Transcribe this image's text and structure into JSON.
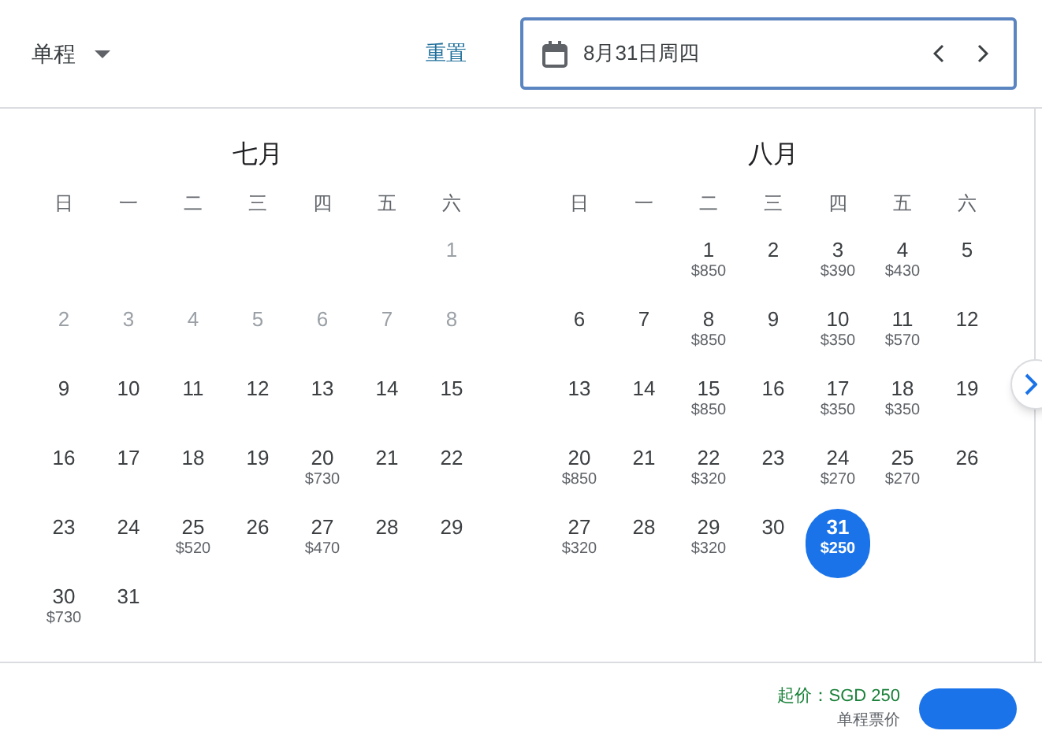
{
  "header": {
    "trip_type": "单程",
    "reset": "重置",
    "date": "8月31日周四"
  },
  "months": [
    {
      "title": "七月",
      "weekdays": [
        "日",
        "一",
        "二",
        "三",
        "四",
        "五",
        "六"
      ],
      "weeks": [
        [
          {
            "kind": "blank"
          },
          {
            "kind": "blank"
          },
          {
            "kind": "blank"
          },
          {
            "kind": "blank"
          },
          {
            "kind": "blank"
          },
          {
            "kind": "blank"
          },
          {
            "day": "1",
            "disabled": true,
            "selected": false
          }
        ],
        [
          {
            "day": "2",
            "disabled": true,
            "selected": false
          },
          {
            "day": "3",
            "disabled": true,
            "selected": false
          },
          {
            "day": "4",
            "disabled": true,
            "selected": false
          },
          {
            "day": "5",
            "disabled": true,
            "selected": false
          },
          {
            "day": "6",
            "disabled": true,
            "selected": false
          },
          {
            "day": "7",
            "disabled": true,
            "selected": false
          },
          {
            "day": "8",
            "disabled": true,
            "selected": false
          }
        ],
        [
          {
            "day": "9",
            "disabled": false,
            "selected": false
          },
          {
            "day": "10",
            "disabled": false,
            "selected": false
          },
          {
            "day": "11",
            "disabled": false,
            "selected": false
          },
          {
            "day": "12",
            "disabled": false,
            "selected": false
          },
          {
            "day": "13",
            "disabled": false,
            "selected": false
          },
          {
            "day": "14",
            "disabled": false,
            "selected": false
          },
          {
            "day": "15",
            "disabled": false,
            "selected": false
          }
        ],
        [
          {
            "day": "16",
            "disabled": false,
            "selected": false
          },
          {
            "day": "17",
            "disabled": false,
            "selected": false
          },
          {
            "day": "18",
            "disabled": false,
            "selected": false
          },
          {
            "day": "19",
            "disabled": false,
            "selected": false
          },
          {
            "day": "20",
            "price": "$730",
            "disabled": false,
            "selected": false
          },
          {
            "day": "21",
            "disabled": false,
            "selected": false
          },
          {
            "day": "22",
            "disabled": false,
            "selected": false
          }
        ],
        [
          {
            "day": "23",
            "disabled": false,
            "selected": false
          },
          {
            "day": "24",
            "disabled": false,
            "selected": false
          },
          {
            "day": "25",
            "price": "$520",
            "disabled": false,
            "selected": false
          },
          {
            "day": "26",
            "disabled": false,
            "selected": false
          },
          {
            "day": "27",
            "price": "$470",
            "disabled": false,
            "selected": false
          },
          {
            "day": "28",
            "disabled": false,
            "selected": false
          },
          {
            "day": "29",
            "disabled": false,
            "selected": false
          }
        ],
        [
          {
            "day": "30",
            "price": "$730",
            "disabled": false,
            "selected": false
          },
          {
            "day": "31",
            "disabled": false,
            "selected": false
          }
        ]
      ]
    },
    {
      "title": "八月",
      "weekdays": [
        "日",
        "一",
        "二",
        "三",
        "四",
        "五",
        "六"
      ],
      "weeks": [
        [
          {
            "kind": "blank"
          },
          {
            "kind": "blank"
          },
          {
            "day": "1",
            "price": "$850",
            "disabled": false,
            "selected": false
          },
          {
            "day": "2",
            "disabled": false,
            "selected": false
          },
          {
            "day": "3",
            "price": "$390",
            "disabled": false,
            "selected": false
          },
          {
            "day": "4",
            "price": "$430",
            "disabled": false,
            "selected": false
          },
          {
            "day": "5",
            "disabled": false,
            "selected": false
          }
        ],
        [
          {
            "day": "6",
            "disabled": false,
            "selected": false
          },
          {
            "day": "7",
            "disabled": false,
            "selected": false
          },
          {
            "day": "8",
            "price": "$850",
            "disabled": false,
            "selected": false
          },
          {
            "day": "9",
            "disabled": false,
            "selected": false
          },
          {
            "day": "10",
            "price": "$350",
            "disabled": false,
            "selected": false
          },
          {
            "day": "11",
            "price": "$570",
            "disabled": false,
            "selected": false
          },
          {
            "day": "12",
            "disabled": false,
            "selected": false
          }
        ],
        [
          {
            "day": "13",
            "disabled": false,
            "selected": false
          },
          {
            "day": "14",
            "disabled": false,
            "selected": false
          },
          {
            "day": "15",
            "price": "$850",
            "disabled": false,
            "selected": false
          },
          {
            "day": "16",
            "disabled": false,
            "selected": false
          },
          {
            "day": "17",
            "price": "$350",
            "disabled": false,
            "selected": false
          },
          {
            "day": "18",
            "price": "$350",
            "disabled": false,
            "selected": false
          },
          {
            "day": "19",
            "disabled": false,
            "selected": false
          }
        ],
        [
          {
            "day": "20",
            "price": "$850",
            "disabled": false,
            "selected": false
          },
          {
            "day": "21",
            "disabled": false,
            "selected": false
          },
          {
            "day": "22",
            "price": "$320",
            "disabled": false,
            "selected": false
          },
          {
            "day": "23",
            "disabled": false,
            "selected": false
          },
          {
            "day": "24",
            "price": "$270",
            "disabled": false,
            "selected": false
          },
          {
            "day": "25",
            "price": "$270",
            "disabled": false,
            "selected": false
          },
          {
            "day": "26",
            "disabled": false,
            "selected": false
          }
        ],
        [
          {
            "day": "27",
            "price": "$320",
            "disabled": false,
            "selected": false
          },
          {
            "day": "28",
            "disabled": false,
            "selected": false
          },
          {
            "day": "29",
            "price": "$320",
            "disabled": false,
            "selected": false
          },
          {
            "day": "30",
            "disabled": false,
            "selected": false
          },
          {
            "day": "31",
            "price": "$250",
            "disabled": false,
            "selected": true
          }
        ]
      ]
    }
  ],
  "footer": {
    "lowest_price": "起价：SGD 250",
    "price_note": "单程票价"
  }
}
